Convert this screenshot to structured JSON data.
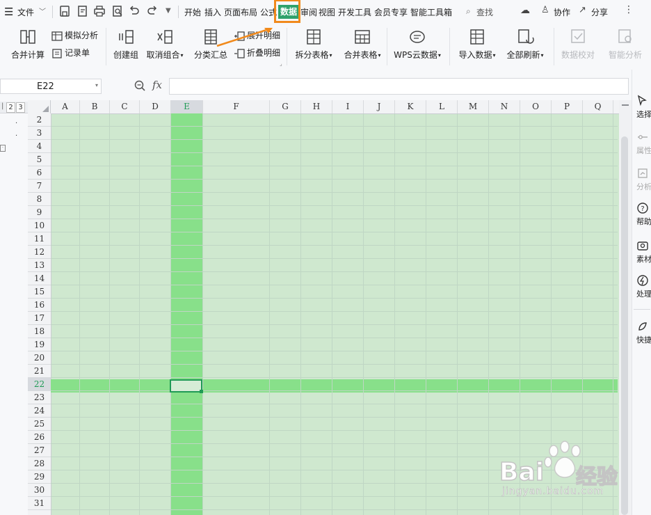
{
  "menu": {
    "file": "文件",
    "tabs": [
      "开始",
      "插入",
      "页面布局",
      "公式",
      "数据",
      "审阅",
      "视图",
      "开发工具",
      "会员专享",
      "智能工具箱"
    ],
    "active_tab": "数据",
    "search": "查找",
    "collab": "协作",
    "share": "分享"
  },
  "ribbon": {
    "merge_calc": "合并计算",
    "simulate": "模拟分析",
    "record": "记录单",
    "create_group": "创建组",
    "ungroup": "取消组合",
    "subtotal": "分类汇总",
    "expand_detail": "展开明细",
    "collapse_detail": "折叠明细",
    "split_table": "拆分表格",
    "merge_table": "合并表格",
    "wps_cloud": "WPS云数据",
    "import_data": "导入数据",
    "refresh_all": "全部刷新",
    "data_check": "数据校对",
    "smart_analysis": "智能分析"
  },
  "formula_bar": {
    "name_box": "E22",
    "fx": "fx",
    "value": ""
  },
  "outline_levels": [
    "2",
    "3"
  ],
  "columns": [
    "A",
    "B",
    "C",
    "D",
    "E",
    "F",
    "G",
    "H",
    "I",
    "J",
    "K",
    "L",
    "M",
    "N",
    "O",
    "P",
    "Q"
  ],
  "rows": [
    "2",
    "3",
    "4",
    "5",
    "6",
    "7",
    "8",
    "9",
    "10",
    "11",
    "12",
    "13",
    "14",
    "15",
    "16",
    "17",
    "18",
    "19",
    "20",
    "21",
    "22",
    "23",
    "24",
    "25",
    "26",
    "27",
    "28",
    "29",
    "30",
    "31"
  ],
  "active_cell": "E22",
  "side_panel": {
    "select": "选择",
    "attr": "属性",
    "analysis": "分析",
    "help": "帮助",
    "material": "素材",
    "process": "处理",
    "quick": "快捷"
  },
  "colors": {
    "active_tab_bg": "#2fa26b",
    "highlight_border": "#f18a1c",
    "sheet_bg": "#cfe8cf",
    "highlight_band": "#88e08a",
    "active_cell_border": "#1f9a55"
  },
  "watermark": {
    "brand": "Bai",
    "brand2": "经验",
    "url": "jingyan.baidu.com"
  }
}
